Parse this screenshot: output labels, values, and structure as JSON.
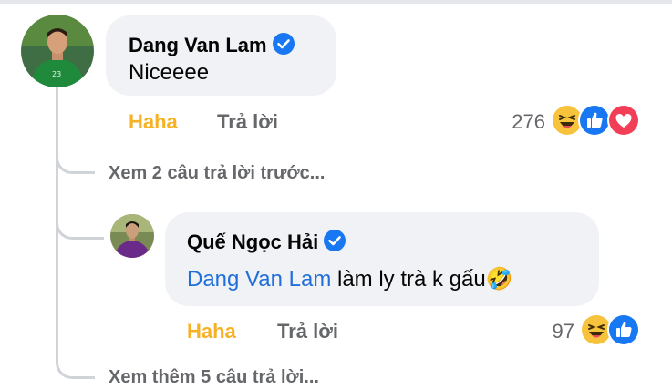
{
  "comment": {
    "author": "Dang Van Lam",
    "text": "Niceeee",
    "actions": {
      "haha": "Haha",
      "reply": "Trả lời"
    },
    "reaction_count": "276",
    "reactions": [
      "haha-emoji",
      "like-icon",
      "love-icon"
    ]
  },
  "previous_replies_link": "Xem 2 câu trả lời trước...",
  "reply": {
    "author": "Quế Ngọc Hải",
    "mention": "Dang Van Lam",
    "text": " làm ly trà k gấu",
    "emoji": "🤣",
    "actions": {
      "haha": "Haha",
      "reply": "Trả lời"
    },
    "reaction_count": "97",
    "reactions": [
      "haha-emoji",
      "like-icon"
    ]
  },
  "more_replies_link": "Xem thêm 5 câu trả lời...",
  "colors": {
    "bubble": "#f0f2f5",
    "haha_text": "#f7b125",
    "mention": "#216fdb",
    "verified": "#1877f2",
    "secondary_text": "#65676b"
  }
}
